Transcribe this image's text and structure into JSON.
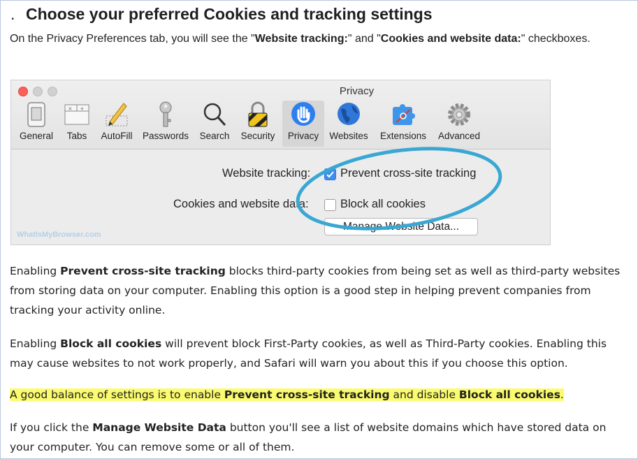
{
  "heading": {
    "bullet": ".",
    "text": "Choose your preferred Cookies and tracking settings"
  },
  "intro": {
    "p1": "On the Privacy Preferences tab, you will see the \"",
    "b1": "Website tracking:",
    "p2": "\" and \"",
    "b2": "Cookies and website data:",
    "p3": "\" checkboxes."
  },
  "safari": {
    "window_title": "Privacy",
    "toolbar": [
      {
        "label": "General",
        "icon": "switch-icon"
      },
      {
        "label": "Tabs",
        "icon": "tabs-icon"
      },
      {
        "label": "AutoFill",
        "icon": "pencil-icon"
      },
      {
        "label": "Passwords",
        "icon": "key-icon"
      },
      {
        "label": "Search",
        "icon": "magnifier-icon"
      },
      {
        "label": "Security",
        "icon": "padlock-icon"
      },
      {
        "label": "Privacy",
        "icon": "hand-icon",
        "active": true
      },
      {
        "label": "Websites",
        "icon": "globe-icon"
      },
      {
        "label": "Extensions",
        "icon": "puzzle-icon"
      },
      {
        "label": "Advanced",
        "icon": "gear-icon"
      }
    ],
    "website_tracking_label": "Website tracking:",
    "prevent_label": "Prevent cross-site tracking",
    "prevent_checked": true,
    "cookies_label": "Cookies and website data:",
    "block_label": "Block all cookies",
    "block_checked": false,
    "manage_button": "Manage Website Data...",
    "watermark": "WhatIsMyBrowser.com",
    "highlight_color": "#3aa7d3"
  },
  "para1": {
    "a": "Enabling ",
    "b": "Prevent cross-site tracking",
    "c": " blocks third-party cookies from being set as well as third-party websites from storing data on your computer. Enabling this option is a good step in helping prevent companies from tracking your activity online."
  },
  "para2": {
    "a": "Enabling ",
    "b": "Block all cookies",
    "c": " will prevent block First-Party cookies, as well as Third-Party cookies. Enabling this may cause websites to not work properly, and Safari will warn you about this if you choose this option."
  },
  "para3": {
    "a": "A good balance of settings is to enable ",
    "b": "Prevent cross-site tracking",
    "c": " and disable ",
    "d": "Block all cookies",
    "e": "."
  },
  "para4": {
    "a": "If you click the ",
    "b": "Manage Website Data",
    "c": " button you'll see a list of website domains which have stored data on your computer. You can remove some or all of them."
  },
  "colors": {
    "highlight": "#fbfb6f",
    "accent": "#3d8ef0",
    "border": "#b9c6dd"
  }
}
